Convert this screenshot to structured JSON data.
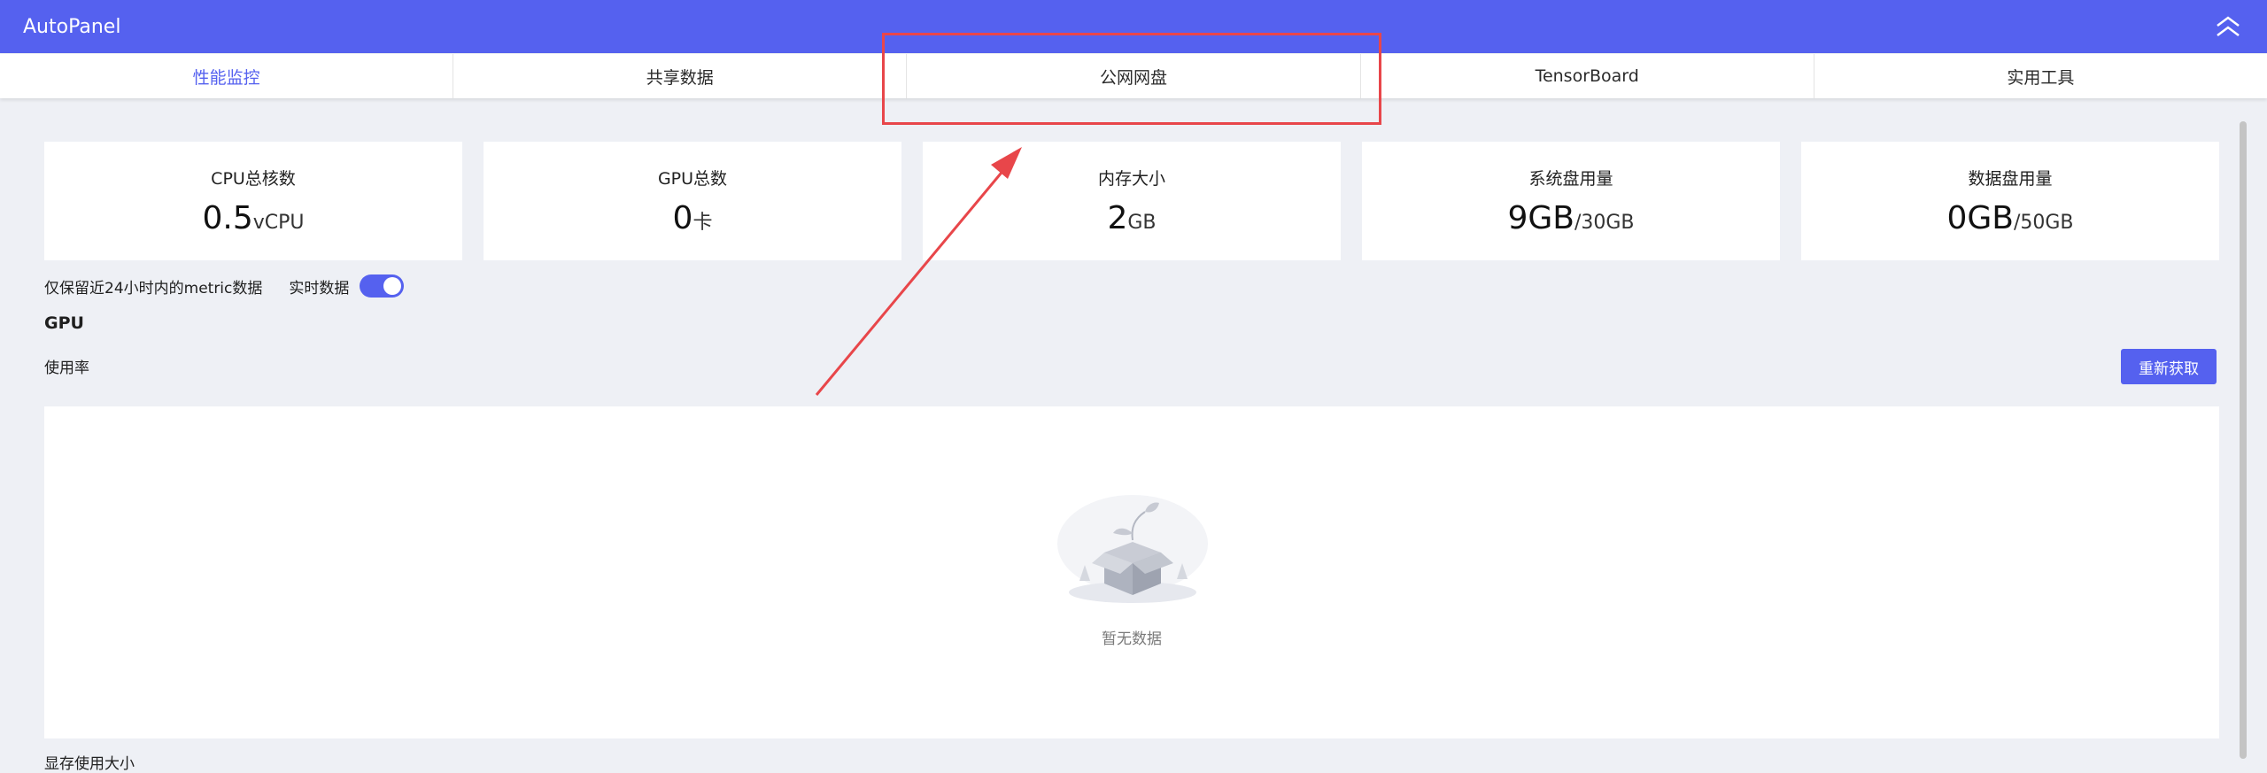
{
  "app": {
    "title": "AutoPanel"
  },
  "tabs": [
    {
      "label": "性能监控",
      "active": true
    },
    {
      "label": "共享数据",
      "active": false
    },
    {
      "label": "公网网盘",
      "active": false
    },
    {
      "label": "TensorBoard",
      "active": false
    },
    {
      "label": "实用工具",
      "active": false
    }
  ],
  "stats": [
    {
      "label": "CPU总核数",
      "value": "0.5",
      "unit": "vCPU"
    },
    {
      "label": "GPU总数",
      "value": "0",
      "unit": "卡"
    },
    {
      "label": "内存大小",
      "value": "2",
      "unit": "GB"
    },
    {
      "label": "系统盘用量",
      "value": "9GB",
      "unit": "/30GB"
    },
    {
      "label": "数据盘用量",
      "value": "0GB",
      "unit": "/50GB"
    }
  ],
  "metrics": {
    "retention_note": "仅保留近24小时内的metric数据",
    "realtime_label": "实时数据",
    "realtime_enabled": true
  },
  "gpu_section": {
    "title": "GPU",
    "usage_label": "使用率",
    "refresh_label": "重新获取",
    "empty_text": "暂无数据",
    "next_label": "显存使用大小"
  },
  "colors": {
    "primary": "#5561ef",
    "annotation": "#e8464a",
    "background": "#eef0f5"
  },
  "icons": {
    "collapse": "double-chevron-up-icon",
    "empty": "empty-box-icon"
  }
}
